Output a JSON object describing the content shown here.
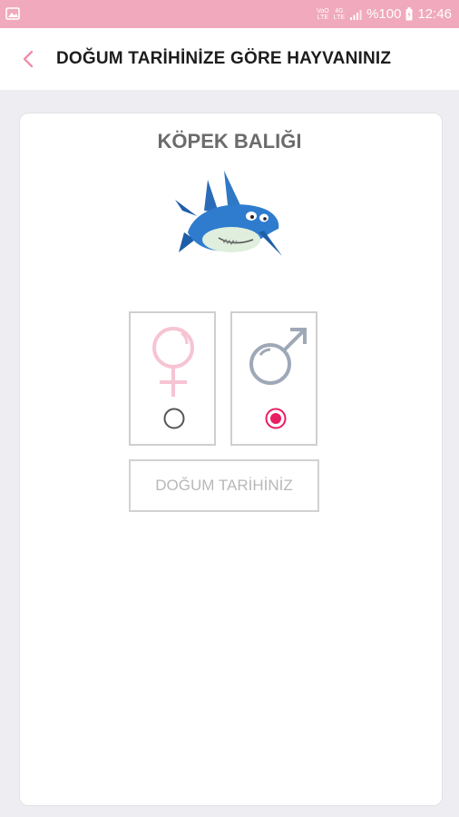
{
  "status_bar": {
    "network_top": "VoO",
    "network_bottom": "LTE",
    "signal_top": "4G",
    "signal_bottom": "LTE",
    "battery": "%100",
    "time": "12:46"
  },
  "header": {
    "title": "DOĞUM TARİHİNİZE GÖRE HAYVANINIZ",
    "back_icon": "chevron-left-icon"
  },
  "result": {
    "animal_name": "KÖPEK BALIĞI",
    "image_icon": "shark-icon"
  },
  "gender": {
    "options": [
      {
        "name": "female",
        "icon": "female-symbol-icon",
        "selected": false
      },
      {
        "name": "male",
        "icon": "male-symbol-icon",
        "selected": true
      }
    ]
  },
  "birthdate_button": {
    "label": "DOĞUM TARİHİNİZ"
  },
  "colors": {
    "status_bar": "#f0a9bd",
    "accent": "#e91e63",
    "female_symbol": "#f6c4d3",
    "male_symbol": "#9fa8b7"
  }
}
